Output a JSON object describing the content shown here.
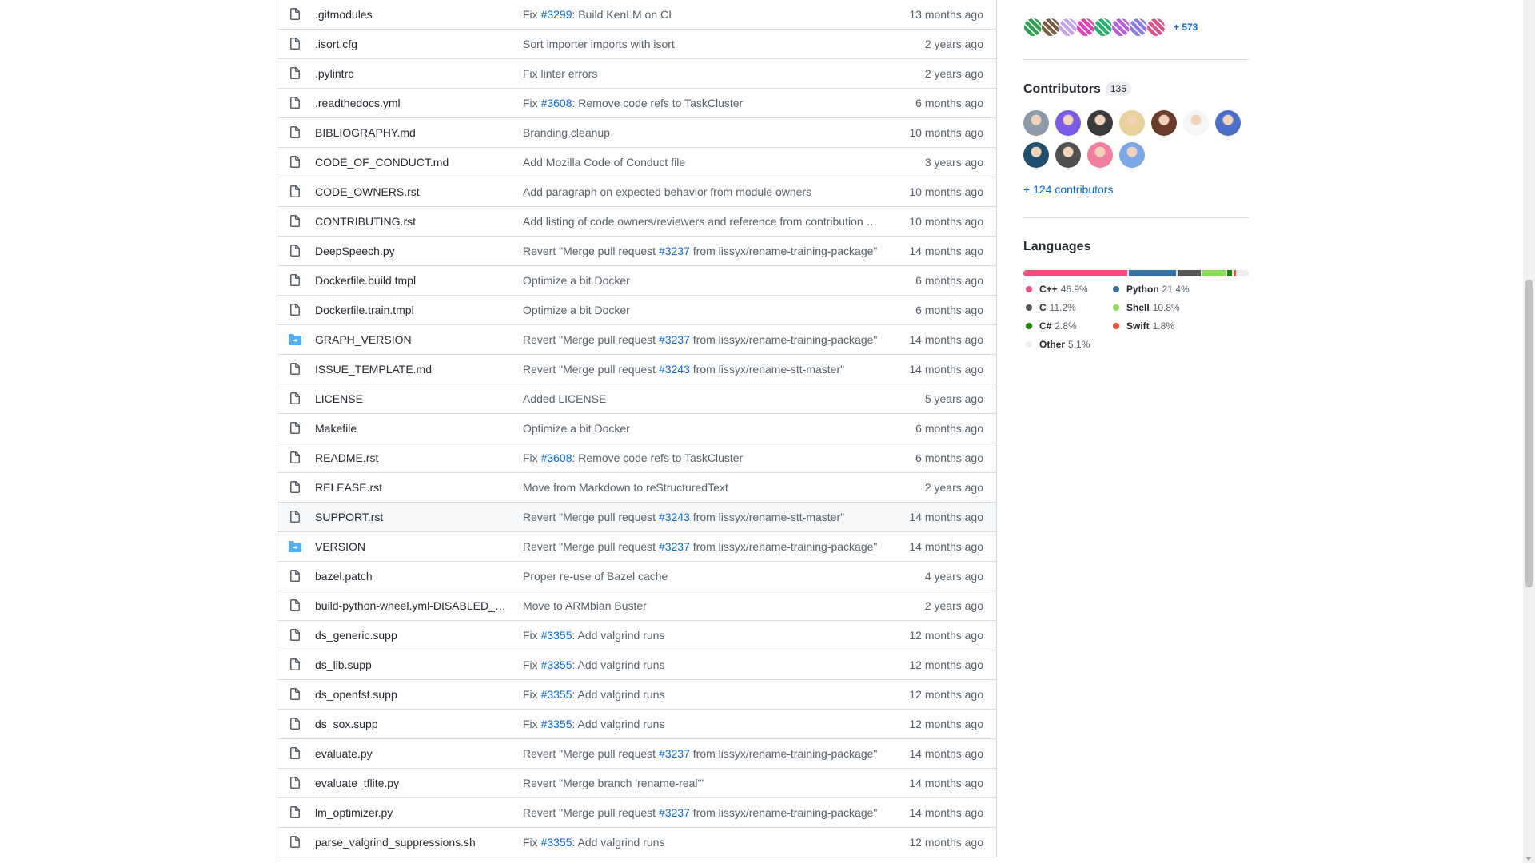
{
  "files": [
    {
      "name": ".gitmodules",
      "type": "file",
      "msg_pre": "Fix ",
      "msg_link": "#3299",
      "msg_post": ": Build KenLM on CI",
      "time": "13 months ago"
    },
    {
      "name": ".isort.cfg",
      "type": "file",
      "msg_pre": "Sort importer imports with isort",
      "msg_link": "",
      "msg_post": "",
      "time": "2 years ago"
    },
    {
      "name": ".pylintrc",
      "type": "file",
      "msg_pre": "Fix linter errors",
      "msg_link": "",
      "msg_post": "",
      "time": "2 years ago"
    },
    {
      "name": ".readthedocs.yml",
      "type": "file",
      "msg_pre": "Fix ",
      "msg_link": "#3608",
      "msg_post": ": Remove code refs to TaskCluster",
      "time": "6 months ago"
    },
    {
      "name": "BIBLIOGRAPHY.md",
      "type": "file",
      "msg_pre": "Branding cleanup",
      "msg_link": "",
      "msg_post": "",
      "time": "10 months ago"
    },
    {
      "name": "CODE_OF_CONDUCT.md",
      "type": "file",
      "msg_pre": "Add Mozilla Code of Conduct file",
      "msg_link": "",
      "msg_post": "",
      "time": "3 years ago"
    },
    {
      "name": "CODE_OWNERS.rst",
      "type": "file",
      "msg_pre": "Add paragraph on expected behavior from module owners",
      "msg_link": "",
      "msg_post": "",
      "time": "10 months ago"
    },
    {
      "name": "CONTRIBUTING.rst",
      "type": "file",
      "msg_pre": "Add listing of code owners/reviewers and reference from contribution …",
      "msg_link": "",
      "msg_post": "",
      "time": "10 months ago"
    },
    {
      "name": "DeepSpeech.py",
      "type": "file",
      "msg_pre": "Revert \"Merge pull request ",
      "msg_link": "#3237",
      "msg_post": " from lissyx/rename-training-package\"",
      "time": "14 months ago"
    },
    {
      "name": "Dockerfile.build.tmpl",
      "type": "file",
      "msg_pre": "Optimize a bit Docker",
      "msg_link": "",
      "msg_post": "",
      "time": "6 months ago"
    },
    {
      "name": "Dockerfile.train.tmpl",
      "type": "file",
      "msg_pre": "Optimize a bit Docker",
      "msg_link": "",
      "msg_post": "",
      "time": "6 months ago"
    },
    {
      "name": "GRAPH_VERSION",
      "type": "symlink",
      "msg_pre": "Revert \"Merge pull request ",
      "msg_link": "#3237",
      "msg_post": " from lissyx/rename-training-package\"",
      "time": "14 months ago"
    },
    {
      "name": "ISSUE_TEMPLATE.md",
      "type": "file",
      "msg_pre": "Revert \"Merge pull request ",
      "msg_link": "#3243",
      "msg_post": " from lissyx/rename-stt-master\"",
      "time": "14 months ago"
    },
    {
      "name": "LICENSE",
      "type": "file",
      "msg_pre": "Added LICENSE",
      "msg_link": "",
      "msg_post": "",
      "time": "5 years ago"
    },
    {
      "name": "Makefile",
      "type": "file",
      "msg_pre": "Optimize a bit Docker",
      "msg_link": "",
      "msg_post": "",
      "time": "6 months ago"
    },
    {
      "name": "README.rst",
      "type": "file",
      "msg_pre": "Fix ",
      "msg_link": "#3608",
      "msg_post": ": Remove code refs to TaskCluster",
      "time": "6 months ago"
    },
    {
      "name": "RELEASE.rst",
      "type": "file",
      "msg_pre": "Move from Markdown to reStructuredText",
      "msg_link": "",
      "msg_post": "",
      "time": "2 years ago"
    },
    {
      "name": "SUPPORT.rst",
      "type": "file",
      "highlight": true,
      "msg_pre": "Revert \"Merge pull request ",
      "msg_link": "#3243",
      "msg_post": " from lissyx/rename-stt-master\"",
      "time": "14 months ago"
    },
    {
      "name": "VERSION",
      "type": "symlink",
      "msg_pre": "Revert \"Merge pull request ",
      "msg_link": "#3237",
      "msg_post": " from lissyx/rename-training-package\"",
      "time": "14 months ago"
    },
    {
      "name": "bazel.patch",
      "type": "file",
      "msg_pre": "Proper re-use of Bazel cache",
      "msg_link": "",
      "msg_post": "",
      "time": "4 years ago"
    },
    {
      "name": "build-python-wheel.yml-DISABLED_…",
      "type": "file",
      "msg_pre": "Move to ARMbian Buster",
      "msg_link": "",
      "msg_post": "",
      "time": "2 years ago"
    },
    {
      "name": "ds_generic.supp",
      "type": "file",
      "msg_pre": "Fix ",
      "msg_link": "#3355",
      "msg_post": ": Add valgrind runs",
      "time": "12 months ago"
    },
    {
      "name": "ds_lib.supp",
      "type": "file",
      "msg_pre": "Fix ",
      "msg_link": "#3355",
      "msg_post": ": Add valgrind runs",
      "time": "12 months ago"
    },
    {
      "name": "ds_openfst.supp",
      "type": "file",
      "msg_pre": "Fix ",
      "msg_link": "#3355",
      "msg_post": ": Add valgrind runs",
      "time": "12 months ago"
    },
    {
      "name": "ds_sox.supp",
      "type": "file",
      "msg_pre": "Fix ",
      "msg_link": "#3355",
      "msg_post": ": Add valgrind runs",
      "time": "12 months ago"
    },
    {
      "name": "evaluate.py",
      "type": "file",
      "msg_pre": "Revert \"Merge pull request ",
      "msg_link": "#3237",
      "msg_post": " from lissyx/rename-training-package\"",
      "time": "14 months ago"
    },
    {
      "name": "evaluate_tflite.py",
      "type": "file",
      "msg_pre": "Revert \"Merge branch 'rename-real'\"",
      "msg_link": "",
      "msg_post": "",
      "time": "14 months ago"
    },
    {
      "name": "lm_optimizer.py",
      "type": "file",
      "msg_pre": "Revert \"Merge pull request ",
      "msg_link": "#3237",
      "msg_post": " from lissyx/rename-training-package\"",
      "time": "14 months ago"
    },
    {
      "name": "parse_valgrind_suppressions.sh",
      "type": "file",
      "msg_pre": "Fix ",
      "msg_link": "#3355",
      "msg_post": ": Add valgrind runs",
      "time": "12 months ago"
    }
  ],
  "used_by": {
    "more_label": "+ 573",
    "avatar_colors": [
      "#2da44e",
      "#7b5d3f",
      "#c8a2e8",
      "#e63cbf",
      "#20b26a",
      "#b95cd6",
      "#8b7ae8",
      "#e04d8f"
    ]
  },
  "contributors": {
    "title": "Contributors",
    "count": "135",
    "more_link": "+ 124 contributors",
    "avatar_colors": [
      "#8a9aa8",
      "#7b5ae8",
      "#3a3a3a",
      "#e8d29a",
      "#6b3a2a",
      "#f5f5f5",
      "#4a6fc8",
      "#1f4f6f",
      "#505050",
      "#f27fa0",
      "#7aa8e8"
    ]
  },
  "languages": {
    "title": "Languages",
    "items": [
      {
        "name": "C++",
        "percent": "46.9%",
        "value": 46.9,
        "color": "#f34b7d"
      },
      {
        "name": "Python",
        "percent": "21.4%",
        "value": 21.4,
        "color": "#3572A5"
      },
      {
        "name": "C",
        "percent": "11.2%",
        "value": 11.2,
        "color": "#555555"
      },
      {
        "name": "Shell",
        "percent": "10.8%",
        "value": 10.8,
        "color": "#89e051"
      },
      {
        "name": "C#",
        "percent": "2.8%",
        "value": 2.8,
        "color": "#178600"
      },
      {
        "name": "Swift",
        "percent": "1.8%",
        "value": 1.8,
        "color": "#F05138"
      },
      {
        "name": "Other",
        "percent": "5.1%",
        "value": 5.1,
        "color": "#ededed"
      }
    ]
  }
}
